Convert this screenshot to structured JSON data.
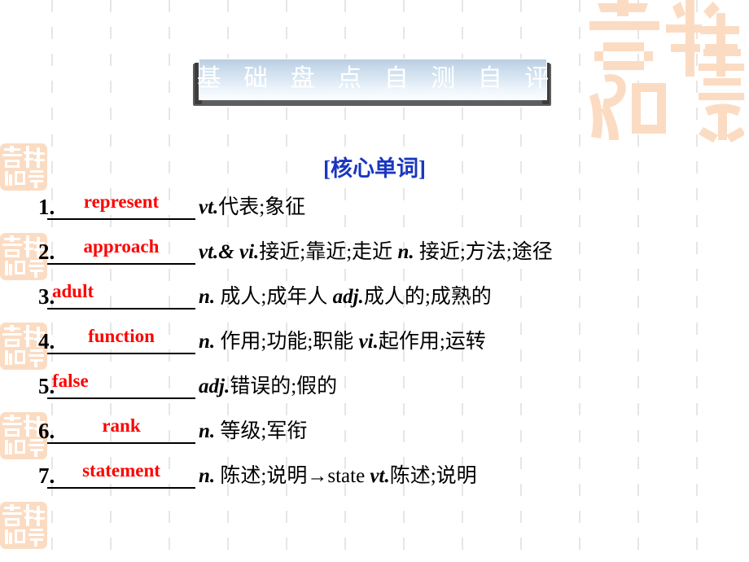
{
  "slide": {
    "title": "基 础 盘 点 自 测 自 评",
    "section_heading": "[核心单词]",
    "accent_word_color": "#ff0000",
    "heading_color": "#1a36c0",
    "banner_color": "#c9dbeb",
    "seal_color": "#fbdcc3",
    "grid_color": "#e6e6e6"
  },
  "vocab": [
    {
      "num": "1.",
      "word": "represent",
      "pos1": "vt.",
      "def1": "代表;象征",
      "pos2": "",
      "def2": "",
      "full": "vt.代表;象征"
    },
    {
      "num": "2.",
      "word": "approach",
      "pos1": "vt.& vi.",
      "def1": "接近;靠近;走近",
      "pos2": "n.",
      "def2": " 接近;方法;途径",
      "full": "vt.& vi.接近;靠近;走近 n. 接近;方法;途径"
    },
    {
      "num": "3.",
      "word": "adult",
      "pos1": "n.",
      "def1": "  成人;成年人",
      "pos2": "adj.",
      "def2": "成人的;成熟的",
      "full": "n． 成人;成年人 adj.成人的;成熟的"
    },
    {
      "num": "4.",
      "word": "function",
      "pos1": "n.",
      "def1": "  作用;功能;职能",
      "pos2": "vi.",
      "def2": "起作用;运转",
      "full": "n． 作用;功能;职能 vi.起作用;运转"
    },
    {
      "num": "5.",
      "word": "false",
      "pos1": "adj.",
      "def1": "错误的;假的",
      "pos2": "",
      "def2": "",
      "full": "adj.错误的;假的"
    },
    {
      "num": "6.",
      "word": "rank",
      "pos1": "n.",
      "def1": "  等级;军衔",
      "pos2": "",
      "def2": "",
      "full": "n． 等级;军衔"
    },
    {
      "num": "7.",
      "word": "statement",
      "pos1": "n.",
      "def1": "  陈述;说明→state ",
      "pos2": "vt.",
      "def2": "陈述;说明",
      "full": "n． 陈述;说明→state vt.陈述;说明"
    }
  ],
  "decorations": {
    "large_seal_name": "seal-stamp-large",
    "small_seal_name": "seal-stamp-small",
    "small_seal_count": 5
  }
}
